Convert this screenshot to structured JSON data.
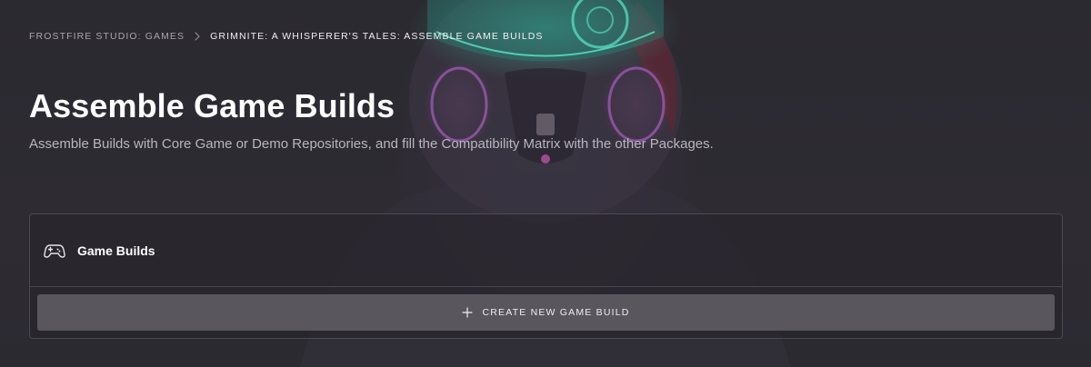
{
  "breadcrumb": {
    "items": [
      {
        "label": "FROSTFIRE STUDIO: GAMES"
      },
      {
        "label": "GRIMNITE: A WHISPERER'S TALES: ASSEMBLE GAME BUILDS"
      }
    ],
    "separator_icon": "chevron-right-icon"
  },
  "header": {
    "title": "Assemble Game Builds",
    "subtitle": "Assemble Builds with Core Game or Demo Repositories, and fill the Compatibility Matrix with the other Packages."
  },
  "panel": {
    "title": "Game Builds",
    "icon": "gamepad-icon",
    "create_button_label": "CREATE NEW GAME BUILD",
    "create_button_icon": "plus-icon"
  },
  "colors": {
    "background": "#2c2a31",
    "button": "#59575d",
    "accent_teal": "#3fd6b4",
    "accent_pink": "#e063c8"
  }
}
